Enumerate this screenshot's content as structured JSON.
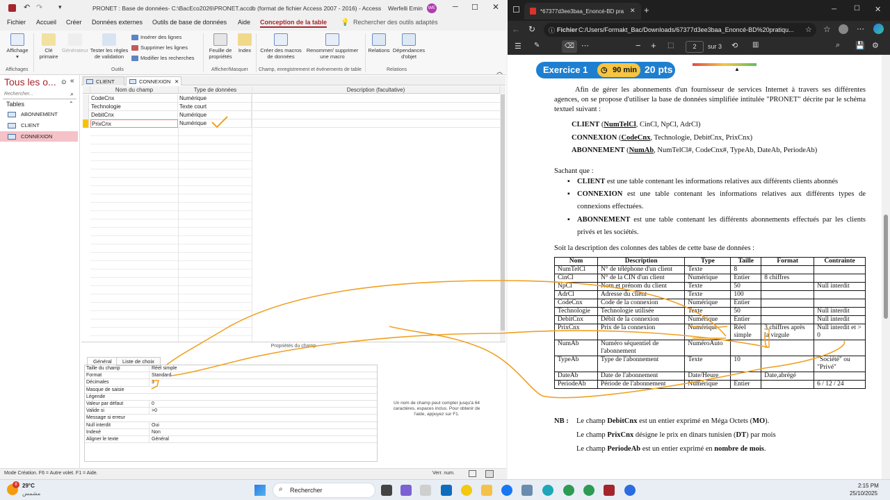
{
  "access": {
    "title": "PRONET : Base de données- C:\\BacEco2026\\PRONET.accdb (format de fichier Access 2007 - 2016)  -  Access",
    "user": "Werfelli Emin",
    "user_initials": "WE",
    "ribbon_tabs": [
      "Fichier",
      "Accueil",
      "Créer",
      "Données externes",
      "Outils de base de données",
      "Aide",
      "Conception de la table"
    ],
    "search_tools": "Rechercher des outils adaptés",
    "ribbon": {
      "affichage": "Affichage",
      "cle_primaire": "Clé primaire",
      "generateur": "Générateur",
      "tester": "Tester les règles de validation",
      "inserer": "Insérer des lignes",
      "supprimer": "Supprimer les lignes",
      "modifier": "Modifier les recherches",
      "feuille": "Feuille de propriétés",
      "index": "Index",
      "creer_macros": "Créer des macros de données",
      "renommer": "Renommer/ supprimer une macro",
      "relations": "Relations",
      "dependances": "Dépendances d'objet",
      "groups": [
        "Affichages",
        "Outils",
        "Afficher/Masquer",
        "Champ, enregistrement et événements de table",
        "Relations"
      ]
    },
    "nav": {
      "title": "Tous les o...",
      "search_placeholder": "Rechercher...",
      "section": "Tables",
      "items": [
        "ABONNEMENT",
        "CLIENT",
        "CONNEXION"
      ]
    },
    "open_tabs": [
      "CLIENT",
      "CONNEXION"
    ],
    "grid_headers": [
      "Nom du champ",
      "Type de données",
      "Description (facultative)"
    ],
    "fields": [
      {
        "name": "CodeCnx",
        "type": "Numérique"
      },
      {
        "name": "Technologie",
        "type": "Texte court"
      },
      {
        "name": "DebitCnx",
        "type": "Numérique"
      },
      {
        "name": "PrixCnx",
        "type": "Numérique"
      }
    ],
    "properties_title": "Propriétés du champ",
    "property_tabs": [
      "Général",
      "Liste de choix"
    ],
    "properties": [
      {
        "k": "Taille du champ",
        "v": "Réel simple"
      },
      {
        "k": "Format",
        "v": "Standard"
      },
      {
        "k": "Décimales",
        "v": "3"
      },
      {
        "k": "Masque de saisie",
        "v": ""
      },
      {
        "k": "Légende",
        "v": ""
      },
      {
        "k": "Valeur par défaut",
        "v": "0"
      },
      {
        "k": "Valide si",
        "v": ">0"
      },
      {
        "k": "Message si erreur",
        "v": ""
      },
      {
        "k": "Null interdit",
        "v": "Oui"
      },
      {
        "k": "Indexé",
        "v": "Non"
      },
      {
        "k": "Aligner le texte",
        "v": "Général"
      }
    ],
    "help": "Un nom de champ peut compter jusqu'à 64 caractères, espaces inclus. Pour obtenir de l'aide, appuyez sur F1.",
    "status_left": "Mode Création. F6 = Autre volet. F1 = Aide.",
    "status_right": "Verr. num."
  },
  "pdf": {
    "tab_title": "*67377d3ee3baa_Enoncé-BD pra",
    "address_label": "Fichier",
    "address": "C:/Users/Formakt_Bac/Downloads/67377d3ee3baa_Enoncé-BD%20pratiqu...",
    "page_current": "2",
    "page_total": "sur 3",
    "exercise_label": "Exercice 1",
    "duration": "90 min",
    "points": "20 pts",
    "intro": "Afin de gérer les abonnements d'un fournisseur de services Internet à travers ses différentes agences, on se propose d'utiliser la base de données simplifiée intitulée \"PRONET\" décrite par le schéma textuel suivant :",
    "schema": [
      {
        "name": "CLIENT",
        "key": "NumTelCl",
        "rest": ", CinCl, NpCl, AdrCl)"
      },
      {
        "name": "CONNEXION",
        "key": "CodeCnx",
        "rest": ", Technologie, DebitCnx, PrixCnx)"
      },
      {
        "name": "ABONNEMENT",
        "key": "NumAb",
        "rest": ", NumTelCl#, CodeCnx#, TypeAb, DateAb, PeriodeAb)"
      }
    ],
    "sachant": "Sachant que :",
    "bullets": [
      {
        "b": "CLIENT",
        "t": " est une table contenant les informations relatives aux différents clients abonnés"
      },
      {
        "b": "CONNEXION",
        "t": " est une table contenant les informations relatives aux différents types de connexions effectuées."
      },
      {
        "b": "ABONNEMENT",
        "t": " est une table contenant les différents abonnements effectués par les clients privés et les sociétés."
      }
    ],
    "table_intro": "Soit la description des colonnes des tables de cette base de données :",
    "table_headers": [
      "Nom",
      "Description",
      "Type",
      "Taille",
      "Format",
      "Contrainte"
    ],
    "table_rows": [
      [
        "NumTelCl",
        "N° de téléphone d'un client",
        "Texte",
        "8",
        "",
        ""
      ],
      [
        "CinCl",
        "N° de la CIN d'un client",
        "Numérique",
        "Entier",
        "8 chiffres",
        ""
      ],
      [
        "NpCl",
        "Nom et prénom du client",
        "Texte",
        "50",
        "",
        "Null interdit"
      ],
      [
        "AdrCl",
        "Adresse du client",
        "Texte",
        "100",
        "",
        ""
      ],
      [
        "CodeCnx",
        "Code de la connexion",
        "Numérique",
        "Entier",
        "",
        ""
      ],
      [
        "Technologie",
        "Technologie utilisée",
        "Texte",
        "50",
        "",
        "Null interdit"
      ],
      [
        "DebitCnx",
        "Débit de la connexion",
        "Numérique",
        "Entier",
        "",
        "Null interdit"
      ],
      [
        "PrixCnx",
        "Prix de la connexion",
        "Numérique",
        "Réel simple",
        "3 chiffres après la virgule",
        "Null interdit et > 0"
      ],
      [
        "NumAb",
        "Numéro séquentiel de l'abonnement",
        "NuméroAuto",
        "",
        "",
        ""
      ],
      [
        "TypeAb",
        "Type de l'abonnement",
        "Texte",
        "10",
        "",
        "\"Société\" ou \"Privé\""
      ],
      [
        "DateAb",
        "Date de l'abonnement",
        "Date/Heure",
        "",
        "Date,abrégé",
        ""
      ],
      [
        "PeriodeAb",
        "Période de l'abonnement",
        "Numérique",
        "Entier",
        "",
        "6 / 12 / 24"
      ]
    ],
    "nb_label": "NB :",
    "nb": [
      {
        "a": "Le champ ",
        "b": "DebitCnx",
        "c": " est un entier exprimé en Méga Octets (",
        "d": "MO",
        "e": ")."
      },
      {
        "a": "Le champ ",
        "b": "PrixCnx",
        "c": " désigne le prix en dinars tunisien (",
        "d": "DT",
        "e": ") par mois"
      },
      {
        "a": "Le champ ",
        "b": "PeriodeAb",
        "c": " est un entier exprimé en ",
        "d": "nombre de mois",
        "e": "."
      }
    ]
  },
  "taskbar": {
    "weather_temp": "29°C",
    "weather_desc": "مشمس",
    "weather_badge": "8",
    "search": "Rechercher",
    "time": "2:15 PM",
    "date": "25/10/2025"
  },
  "colors": {
    "access_accent": "#a4262c",
    "pdf_badge_blue": "#1e7fd0",
    "ink": "#f0a020"
  }
}
